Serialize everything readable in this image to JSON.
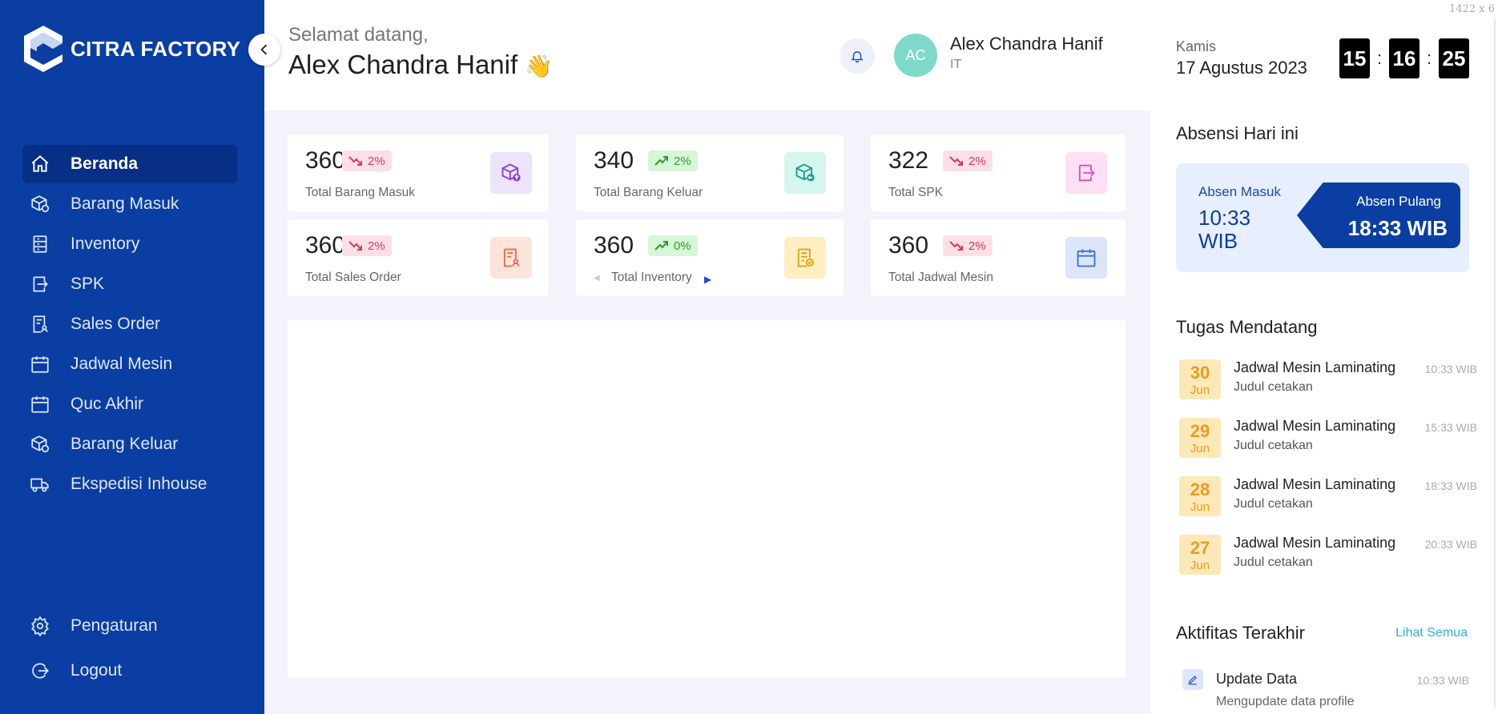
{
  "sidebar": {
    "brand": "CITRA FACTORY",
    "items": [
      {
        "label": "Beranda",
        "icon": "home-icon",
        "active": true
      },
      {
        "label": "Barang Masuk",
        "icon": "box-in-icon"
      },
      {
        "label": "Inventory",
        "icon": "inventory-icon"
      },
      {
        "label": "SPK",
        "icon": "spk-icon"
      },
      {
        "label": "Sales Order",
        "icon": "sales-order-icon"
      },
      {
        "label": "Jadwal Mesin",
        "icon": "calendar-icon"
      },
      {
        "label": "Quc Akhir",
        "icon": "calendar-icon"
      },
      {
        "label": "Barang Keluar",
        "icon": "box-out-icon"
      },
      {
        "label": "Ekspedisi Inhouse",
        "icon": "truck-icon"
      }
    ],
    "bottom": [
      {
        "label": "Pengaturan",
        "icon": "gear-icon"
      },
      {
        "label": "Logout",
        "icon": "logout-icon"
      }
    ]
  },
  "header": {
    "greeting": "Selamat datang,",
    "name": "Alex Chandra Hanif",
    "wave": "👋",
    "user": {
      "initials": "AC",
      "name": "Alex Chandra Hanif",
      "role": "IT"
    }
  },
  "cards": [
    {
      "value": "360",
      "trend": "down",
      "change": "2%",
      "label": "Total Barang Masuk",
      "icon": "box-upload-icon",
      "color": "#8a3ed1",
      "bg": "#ede3fb"
    },
    {
      "value": "340",
      "trend": "up",
      "change": "2%",
      "label": "Total Barang Keluar",
      "icon": "box-download-icon",
      "color": "#1e9c8c",
      "bg": "#d5f5ef"
    },
    {
      "value": "322",
      "trend": "down",
      "change": "2%",
      "label": "Total SPK",
      "icon": "transfer-icon",
      "color": "#e04cb5",
      "bg": "#fde0f3"
    },
    {
      "value": "360",
      "trend": "down",
      "change": "2%",
      "label": "Total Sales Order",
      "icon": "document-user-icon",
      "color": "#e86a4a",
      "bg": "#fde4da"
    },
    {
      "value": "360",
      "trend": "up",
      "change": "0%",
      "label": "Total Inventory",
      "icon": "document-check-icon",
      "color": "#d9a210",
      "bg": "#fdefc1"
    },
    {
      "value": "360",
      "trend": "down",
      "change": "2%",
      "label": "Total Jadwal Mesin",
      "icon": "calendar-icon",
      "color": "#3b6fd8",
      "bg": "#dbe6fb"
    }
  ],
  "date": {
    "day": "Kamis",
    "full": "17 Agustus 2023"
  },
  "clock": {
    "h": "15",
    "m": "16",
    "s": "25",
    "sep": ":"
  },
  "attendance": {
    "title": "Absensi Hari ini",
    "in_label": "Absen Masuk",
    "in_time": "10:33 WIB",
    "out_label": "Absen Pulang",
    "out_time": "18:33 WIB"
  },
  "tasks": {
    "title": "Tugas Mendatang",
    "items": [
      {
        "day": "30",
        "month": "Jun",
        "title": "Jadwal Mesin Laminating",
        "subtitle": "Judul cetakan",
        "time": "10:33 WIB"
      },
      {
        "day": "29",
        "month": "Jun",
        "title": "Jadwal Mesin Laminating",
        "subtitle": "Judul cetakan",
        "time": "15:33 WIB"
      },
      {
        "day": "28",
        "month": "Jun",
        "title": "Jadwal Mesin Laminating",
        "subtitle": "Judul cetakan",
        "time": "18:33 WIB"
      },
      {
        "day": "27",
        "month": "Jun",
        "title": "Jadwal Mesin Laminating",
        "subtitle": "Judul cetakan",
        "time": "20:33 WIB"
      }
    ]
  },
  "activity": {
    "title": "Aktifitas Terakhir",
    "see_all": "Lihat Semua",
    "items": [
      {
        "title": "Update Data",
        "subtitle": "Mengupdate data profile",
        "time": "10:33 WIB"
      }
    ]
  },
  "resolution_tag": "1422 x 6"
}
